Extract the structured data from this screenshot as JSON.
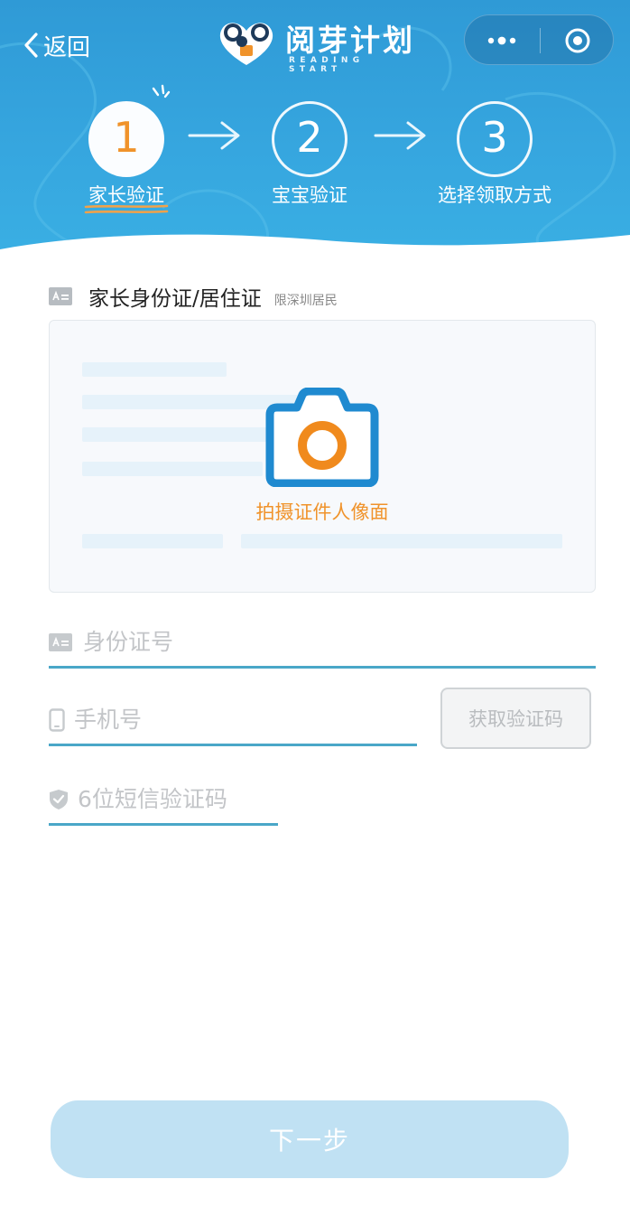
{
  "nav": {
    "back_label": "返回",
    "logo_title": "阅芽计划",
    "logo_subtitle": "READING START"
  },
  "steps": [
    {
      "number": "1",
      "label": "家长验证",
      "active": true
    },
    {
      "number": "2",
      "label": "宝宝验证",
      "active": false
    },
    {
      "number": "3",
      "label": "选择领取方式",
      "active": false
    }
  ],
  "form": {
    "section_title": "家长身份证/居住证",
    "section_note": "限深圳居民",
    "upload_label": "拍摄证件人像面",
    "id_placeholder": "身份证号",
    "phone_placeholder": "手机号",
    "get_code_label": "获取验证码",
    "code_placeholder": "6位短信验证码",
    "next_label": "下一步"
  },
  "colors": {
    "header_blue": "#36a6df",
    "accent_orange": "#f0932b",
    "field_underline": "#4aa7c8",
    "button_disabled": "#c0e1f3"
  },
  "icons": {
    "back": "chevron-left-icon",
    "more": "more-dots-icon",
    "close": "target-circle-icon",
    "id_card": "id-card-icon",
    "phone": "phone-icon",
    "shield": "shield-check-icon",
    "camera": "camera-icon"
  }
}
